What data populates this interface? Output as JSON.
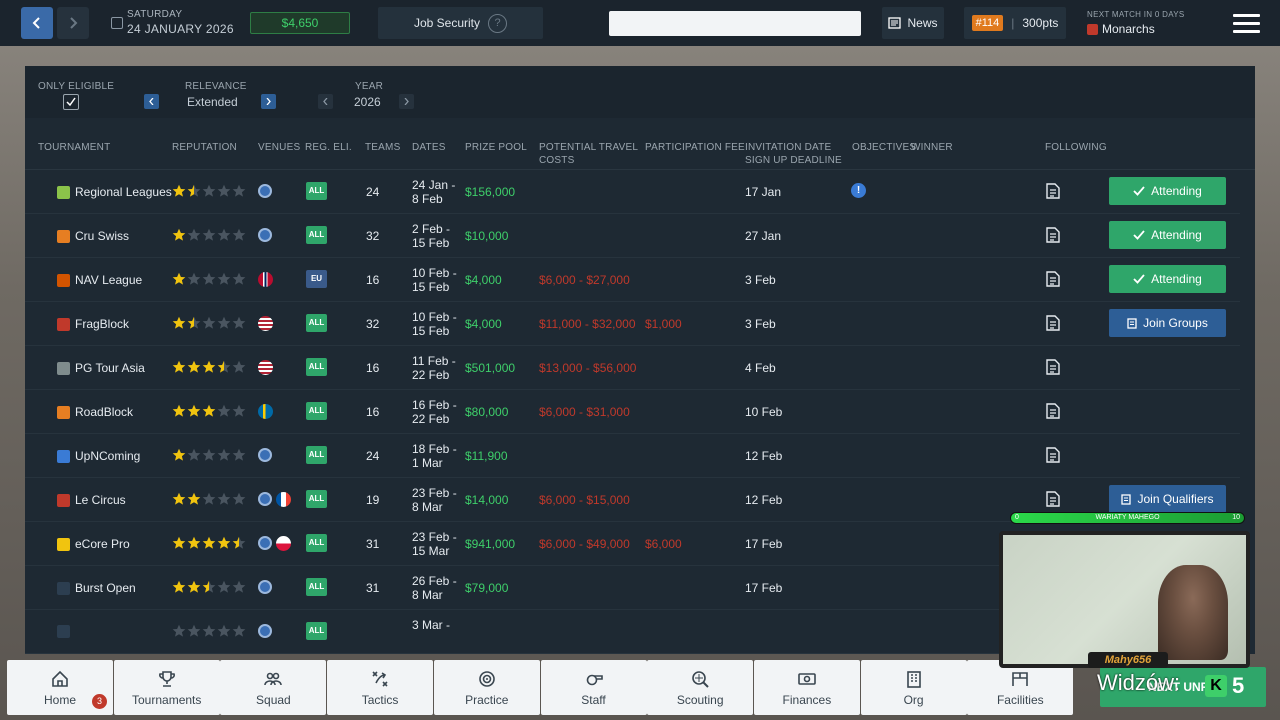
{
  "topbar": {
    "day": "SATURDAY",
    "date": "24 JANUARY 2026",
    "money": "$4,650",
    "job_security": "Job Security",
    "job_help": "?",
    "search_placeholder": "",
    "news": "News",
    "rank": "#114",
    "points": "300pts",
    "next_match_label": "NEXT MATCH IN 0 DAYS",
    "next_match_team": "Monarchs"
  },
  "filters": {
    "only_eligible_label": "ONLY ELIGIBLE",
    "relevance_label": "RELEVANCE",
    "relevance_value": "Extended",
    "year_label": "YEAR",
    "year_value": "2026"
  },
  "columns": {
    "tournament": "TOURNAMENT",
    "reputation": "REPUTATION",
    "venues": "VENUES",
    "reg_eli": "REG. ELI.",
    "teams": "TEAMS",
    "dates": "DATES",
    "prize_pool": "PRIZE POOL",
    "travel_1": "POTENTIAL TRAVEL",
    "travel_2": "COSTS",
    "participation_fee": "PARTICIPATION FEE",
    "invitation_1": "INVITATION DATE",
    "invitation_2": "SIGN UP DEADLINE",
    "objectives": "OBJECTIVES",
    "winner": "WINNER",
    "following": "FOLLOWING"
  },
  "rows": [
    {
      "name": "Regional Leagues",
      "icon_color": "#8bc34a",
      "stars": 1.5,
      "venues": [
        "globe"
      ],
      "elig": "ALL",
      "teams": "24",
      "date1": "24 Jan -",
      "date2": "8 Feb",
      "prize": "$156,000",
      "travel": "",
      "fee": "",
      "invite": "17 Jan",
      "objective": "!",
      "action": "Attending",
      "action_type": "attend"
    },
    {
      "name": "Cru Swiss",
      "icon_color": "#e67e22",
      "stars": 1,
      "venues": [
        "globe"
      ],
      "elig": "ALL",
      "teams": "32",
      "date1": "2 Feb -",
      "date2": "15 Feb",
      "prize": "$10,000",
      "travel": "",
      "fee": "",
      "invite": "27 Jan",
      "objective": "",
      "action": "Attending",
      "action_type": "attend"
    },
    {
      "name": "NAV League",
      "icon_color": "#d35400",
      "stars": 1,
      "venues": [
        "no"
      ],
      "elig": "EU",
      "teams": "16",
      "date1": "10 Feb -",
      "date2": "15 Feb",
      "prize": "$4,000",
      "travel": "$6,000 - $27,000",
      "fee": "",
      "invite": "3 Feb",
      "objective": "",
      "action": "Attending",
      "action_type": "attend"
    },
    {
      "name": "FragBlock",
      "icon_color": "#c0392b",
      "stars": 1.5,
      "venues": [
        "us"
      ],
      "elig": "ALL",
      "teams": "32",
      "date1": "10 Feb -",
      "date2": "15 Feb",
      "prize": "$4,000",
      "travel": "$11,000 - $32,000",
      "fee": "$1,000",
      "invite": "3 Feb",
      "objective": "",
      "action": "Join Groups",
      "action_type": "join"
    },
    {
      "name": "PG Tour Asia",
      "icon_color": "#7f8c8d",
      "stars": 3.5,
      "venues": [
        "us"
      ],
      "elig": "ALL",
      "teams": "16",
      "date1": "11 Feb -",
      "date2": "22 Feb",
      "prize": "$501,000",
      "travel": "$13,000 - $56,000",
      "fee": "",
      "invite": "4 Feb",
      "objective": "",
      "action": "",
      "action_type": ""
    },
    {
      "name": "RoadBlock",
      "icon_color": "#e67e22",
      "stars": 3,
      "venues": [
        "se"
      ],
      "elig": "ALL",
      "teams": "16",
      "date1": "16 Feb -",
      "date2": "22 Feb",
      "prize": "$80,000",
      "travel": "$6,000 - $31,000",
      "fee": "",
      "invite": "10 Feb",
      "objective": "",
      "action": "",
      "action_type": ""
    },
    {
      "name": "UpNComing",
      "icon_color": "#3a7bd5",
      "stars": 1,
      "venues": [
        "globe"
      ],
      "elig": "ALL",
      "teams": "24",
      "date1": "18 Feb -",
      "date2": "1 Mar",
      "prize": "$11,900",
      "travel": "",
      "fee": "",
      "invite": "12 Feb",
      "objective": "",
      "action": "",
      "action_type": ""
    },
    {
      "name": "Le Circus",
      "icon_color": "#c0392b",
      "stars": 2,
      "venues": [
        "globe",
        "fr"
      ],
      "elig": "ALL",
      "teams": "19",
      "date1": "23 Feb -",
      "date2": "8 Mar",
      "prize": "$14,000",
      "travel": "$6,000 - $15,000",
      "fee": "",
      "invite": "12 Feb",
      "objective": "",
      "action": "Join Qualifiers",
      "action_type": "join"
    },
    {
      "name": "eCore Pro",
      "icon_color": "#f1c40f",
      "stars": 4.5,
      "venues": [
        "globe",
        "pl"
      ],
      "elig": "ALL",
      "teams": "31",
      "date1": "23 Feb -",
      "date2": "15 Mar",
      "prize": "$941,000",
      "travel": "$6,000 - $49,000",
      "fee": "$6,000",
      "invite": "17 Feb",
      "objective": "",
      "action": "",
      "action_type": ""
    },
    {
      "name": "Burst Open",
      "icon_color": "#2c3e50",
      "stars": 2.5,
      "venues": [
        "globe"
      ],
      "elig": "ALL",
      "teams": "31",
      "date1": "26 Feb -",
      "date2": "8 Mar",
      "prize": "$79,000",
      "travel": "",
      "fee": "",
      "invite": "17 Feb",
      "objective": "",
      "action": "",
      "action_type": ""
    },
    {
      "name": "",
      "icon_color": "#2c3e50",
      "stars": 0,
      "venues": [
        "globe"
      ],
      "elig": "ALL",
      "teams": "",
      "date1": "3 Mar -",
      "date2": "",
      "prize": "",
      "travel": "",
      "fee": "",
      "invite": "",
      "objective": "",
      "action": "",
      "action_type": ""
    }
  ],
  "bottom_nav": [
    {
      "label": "Home",
      "icon": "home-icon",
      "badge": "3"
    },
    {
      "label": "Tournaments",
      "icon": "trophy-icon"
    },
    {
      "label": "Squad",
      "icon": "squad-icon"
    },
    {
      "label": "Tactics",
      "icon": "tactics-icon"
    },
    {
      "label": "Practice",
      "icon": "practice-icon"
    },
    {
      "label": "Staff",
      "icon": "whistle-icon"
    },
    {
      "label": "Scouting",
      "icon": "scouting-icon"
    },
    {
      "label": "Finances",
      "icon": "finances-icon"
    },
    {
      "label": "Org",
      "icon": "building-icon"
    },
    {
      "label": "Facilities",
      "icon": "facilities-icon"
    }
  ],
  "overlay": {
    "bar_left": "0",
    "bar_text": "WARIATY MAHEGO",
    "bar_right": "10",
    "cam_name": "Mahy656",
    "widzow": "Widzów:",
    "viewer_count": "5",
    "next_round_partial": "NEXT UNRD"
  }
}
